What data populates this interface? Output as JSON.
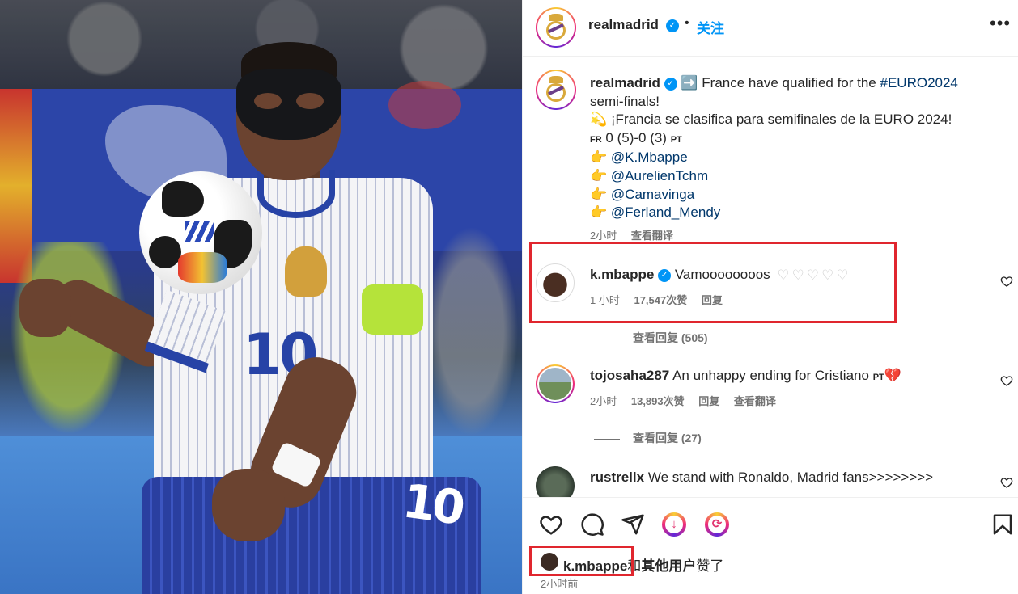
{
  "header": {
    "username": "realmadrid",
    "dot": "•",
    "follow_label": "关注",
    "more_label": "•••"
  },
  "caption": {
    "username": "realmadrid",
    "arrow_emoji": "➡️",
    "line1": " France have qualified for the ",
    "hashtag": "#EURO2024",
    "line1_end": " semi-finals!",
    "spark_emoji": "💫",
    "line2": " ¡Francia se clasifica para semifinales de la EURO 2024!",
    "score_fr": "FR",
    "score": " 0 (5)-0 (3) ",
    "score_pt": "PT",
    "point_emoji": "👉",
    "mentions": [
      "@K.Mbappe",
      "@AurelienTchm",
      "@Camavinga",
      "@Ferland_Mendy"
    ],
    "time": "2小时",
    "translate": "查看翻译"
  },
  "comments": [
    {
      "username": "k.mbappe",
      "text": "Vamoooooooos",
      "hearts": [
        "♡",
        "♡",
        "♡",
        "♡",
        "♡"
      ],
      "time": "1 小时",
      "likes": "17,547次赞",
      "reply": "回复",
      "view_replies": "查看回复 (505)"
    },
    {
      "username": "tojosaha287",
      "text": "An unhappy ending for Cristiano",
      "suffix_sub": "PT",
      "suffix_emoji": "💔",
      "time": "2小时",
      "likes": "13,893次赞",
      "reply": "回复",
      "translate": "查看翻译",
      "view_replies": "查看回复 (27)"
    },
    {
      "username": "rustrellx",
      "text": "We stand with Ronaldo, Madrid fans>>>>>>>>"
    }
  ],
  "footer": {
    "liked_user": "k.mbappe",
    "liked_mid": "和",
    "liked_others": "其他用户",
    "liked_end": "赞了",
    "time_ago": "2小时前"
  },
  "icons": {
    "like": "heart-icon",
    "comment": "comment-icon",
    "share": "share-icon",
    "save": "bookmark-icon"
  },
  "colors": {
    "accent_blue": "#0095f6",
    "link": "#00376b",
    "highlight_red": "#e0262e"
  }
}
